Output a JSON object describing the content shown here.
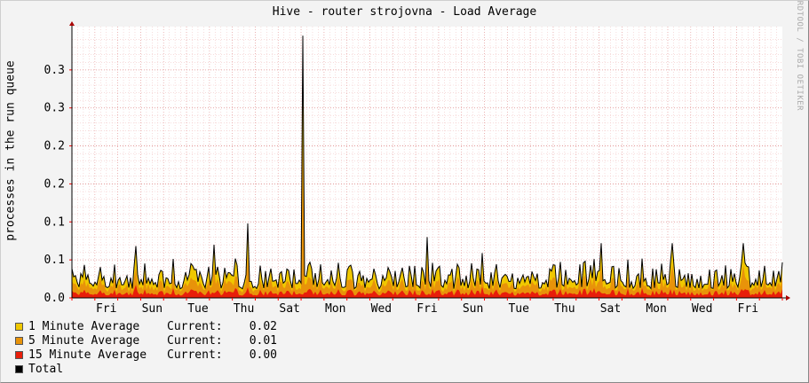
{
  "chart_data": {
    "type": "area",
    "title": "Hive - router strojovna - Load Average",
    "ylabel": "processes in the run queue",
    "watermark": "RRDTOOL / TOBI OETIKER",
    "ylim": [
      0,
      0.35
    ],
    "y_ticks": [
      0.0,
      0.05,
      0.1,
      0.15,
      0.2,
      0.25,
      0.3
    ],
    "y_tick_labels": [
      "0.0",
      "0.1",
      "0.1",
      "0.2",
      "0.2",
      "0.3",
      "0.3"
    ],
    "x_ticks": [
      "Fri",
      "Sun",
      "Tue",
      "Thu",
      "Sat",
      "Mon",
      "Wed",
      "Fri",
      "Sun",
      "Tue",
      "Thu",
      "Sat",
      "Mon",
      "Wed",
      "Fri"
    ],
    "x_range_days": [
      0,
      31
    ],
    "tick_day_positions": [
      1.5,
      3.5,
      5.5,
      7.5,
      9.5,
      11.5,
      13.5,
      15.5,
      17.5,
      19.5,
      21.5,
      23.5,
      25.5,
      27.5,
      29.5
    ],
    "spike": {
      "day": 10.05,
      "value": 0.345
    },
    "series": [
      {
        "name": "1 Minute Average",
        "color": "#f0c800",
        "current": "0.02"
      },
      {
        "name": "5 Minute Average",
        "color": "#e8930a",
        "current": "0.01"
      },
      {
        "name": "15 Minute Average",
        "color": "#e81e0a",
        "current": "0.00"
      },
      {
        "name": "Total",
        "color": "#000000"
      }
    ],
    "current_label": "Current:"
  }
}
